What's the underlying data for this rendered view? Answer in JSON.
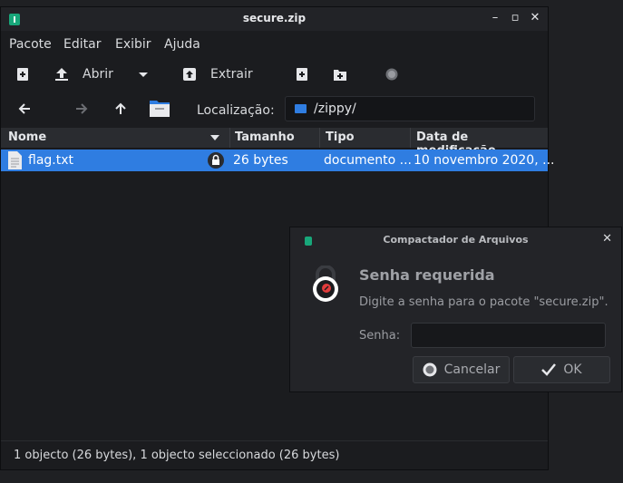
{
  "window": {
    "title": "secure.zip"
  },
  "menubar": [
    "Pacote",
    "Editar",
    "Exibir",
    "Ajuda"
  ],
  "toolbar": {
    "open_label": "Abrir",
    "extract_label": "Extrair"
  },
  "location": {
    "label": "Localização:",
    "path": "/zippy/"
  },
  "columns": [
    "Nome",
    "Tamanho",
    "Tipo",
    "Data de modificação"
  ],
  "files": [
    {
      "name": "flag.txt",
      "size": "26 bytes",
      "type": "documento ...",
      "modified": "10 novembro 2020, ..."
    }
  ],
  "status": "1 objecto (26 bytes), 1 objecto seleccionado (26 bytes)",
  "dialog": {
    "title": "Compactador de Arquivos",
    "heading": "Senha requerida",
    "message": "Digite a senha para o pacote \"secure.zip\".",
    "password_label": "Senha:",
    "password_value": "",
    "cancel_label": "Cancelar",
    "ok_label": "OK"
  },
  "colors": {
    "accent": "#2f7de1",
    "app_green": "#18a77a",
    "lock_red": "#e23c3c"
  }
}
